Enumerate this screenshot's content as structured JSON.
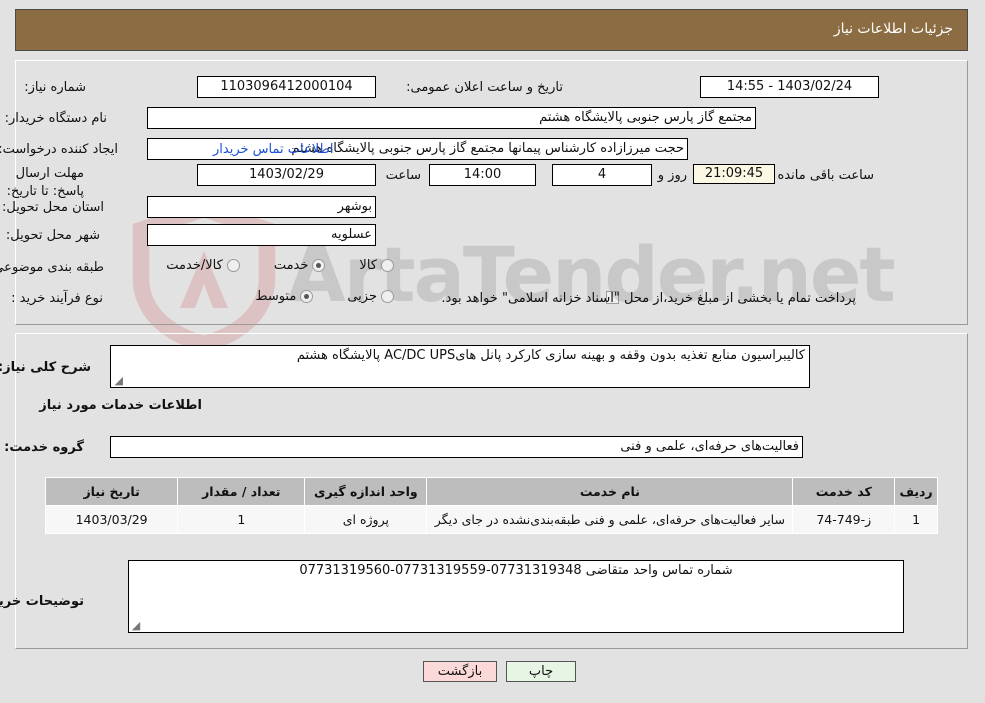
{
  "header": {
    "title": "جزئیات اطلاعات نیاز"
  },
  "form": {
    "need_number_label": "شماره نیاز:",
    "need_number_value": "1103096412000104",
    "announce_label": "تاریخ و ساعت اعلان عمومی:",
    "announce_value": "1403/02/24 - 14:55",
    "buyer_org_label": "نام دستگاه خریدار:",
    "buyer_org_value": "مجتمع گاز پارس جنوبی  پالایشگاه هشتم",
    "creator_label": "ایجاد کننده درخواست:",
    "creator_value": "حجت میرزازاده کارشناس پیمانها مجتمع گاز پارس جنوبی  پالایشگاه هشتم",
    "contact_link": "اطلاعات تماس خریدار",
    "deadline_label": "مهلت ارسال پاسخ: تا تاریخ:",
    "deadline_date": "1403/02/29",
    "hour_label": "ساعت",
    "deadline_hour": "14:00",
    "days_value": "4",
    "days_label": "روز و",
    "countdown_value": "21:09:45",
    "countdown_label": "ساعت باقی مانده",
    "province_label": "استان محل تحویل:",
    "province_value": "بوشهر",
    "city_label": "شهر محل تحویل:",
    "city_value": "عسلویه",
    "category_label": "طبقه بندی موضوعی:",
    "category_options": [
      {
        "label": "کالا",
        "selected": false
      },
      {
        "label": "خدمت",
        "selected": true
      },
      {
        "label": "کالا/خدمت",
        "selected": false
      }
    ],
    "process_label": "نوع فرآیند خرید :",
    "process_options": [
      {
        "label": "جزیی",
        "selected": false
      },
      {
        "label": "متوسط",
        "selected": true
      }
    ],
    "treasury_checkbox_checked": false,
    "treasury_note": "پرداخت تمام یا بخشی از مبلغ خرید،از محل \"اسناد خزانه اسلامی\" خواهد بود."
  },
  "summary": {
    "label": "شرح کلی نیاز:",
    "value": "کالیبراسیون منابع تغذیه بدون وقفه و بهینه سازی کارکرد پانل هایAC/DC UPS  پالایشگاه هشتم"
  },
  "services": {
    "section_title": "اطلاعات خدمات مورد نیاز",
    "group_label": "گروه خدمت:",
    "group_value": "فعالیت‌های حرفه‌ای، علمی و فنی",
    "columns": [
      "ردیف",
      "کد خدمت",
      "نام خدمت",
      "واحد اندازه گیری",
      "تعداد / مقدار",
      "تاریخ نیاز"
    ],
    "rows": [
      {
        "radif": "1",
        "code": "ز-749-74",
        "name": "سایر فعالیت‌های حرفه‌ای، علمی و فنی طبقه‌بندی‌نشده در جای دیگر",
        "unit": "پروژه ای",
        "qty": "1",
        "date": "1403/03/29"
      }
    ]
  },
  "notes": {
    "label": "توضیحات خریدار:",
    "value": "شماره تماس واحد متقاضی 07731319348-07731319559-07731319560"
  },
  "buttons": {
    "print": "چاپ",
    "back": "بازگشت"
  },
  "watermark": {
    "text": "ArtaTender.net"
  }
}
